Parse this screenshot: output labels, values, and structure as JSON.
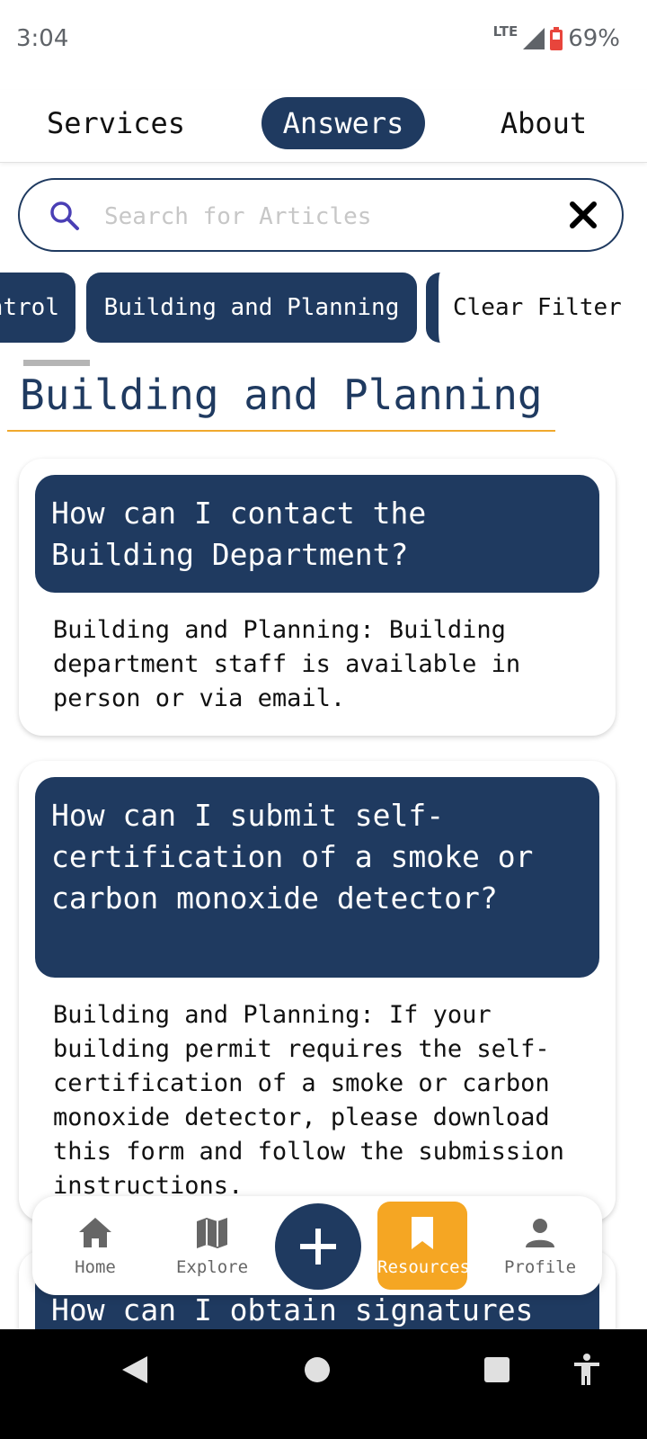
{
  "status_bar": {
    "time": "3:04",
    "network": "LTE",
    "battery": "69%"
  },
  "tabs": [
    {
      "label": "Services"
    },
    {
      "label": "Answers"
    },
    {
      "label": "About"
    }
  ],
  "search": {
    "placeholder": "Search for Articles",
    "value": ""
  },
  "filters": {
    "chips": [
      "ntrol",
      "Building and Planning"
    ],
    "clear_label": "Clear Filter"
  },
  "section": {
    "title": "Building and Planning"
  },
  "articles": [
    {
      "question": "How can I contact the Building Department?",
      "answer": "Building and Planning: Building department staff is available in person or via email."
    },
    {
      "question": "How can I submit self-certification of a smoke or carbon monoxide detector?",
      "answer": "Building and Planning: If your building permit requires the self-certification of a smoke or carbon monoxide detector, please download this form and follow the submission instructions."
    },
    {
      "question": "How can I obtain signatures"
    }
  ],
  "bottom_nav": {
    "items": [
      {
        "label": "Home",
        "icon": "home-icon"
      },
      {
        "label": "Explore",
        "icon": "map-icon"
      },
      {
        "label": "Resources",
        "icon": "bookmark-icon"
      },
      {
        "label": "Profile",
        "icon": "person-icon"
      }
    ],
    "add_icon": "plus-icon"
  },
  "colors": {
    "primary": "#1f3a60",
    "accent": "#f5a623",
    "divider": "#f0a92d"
  }
}
